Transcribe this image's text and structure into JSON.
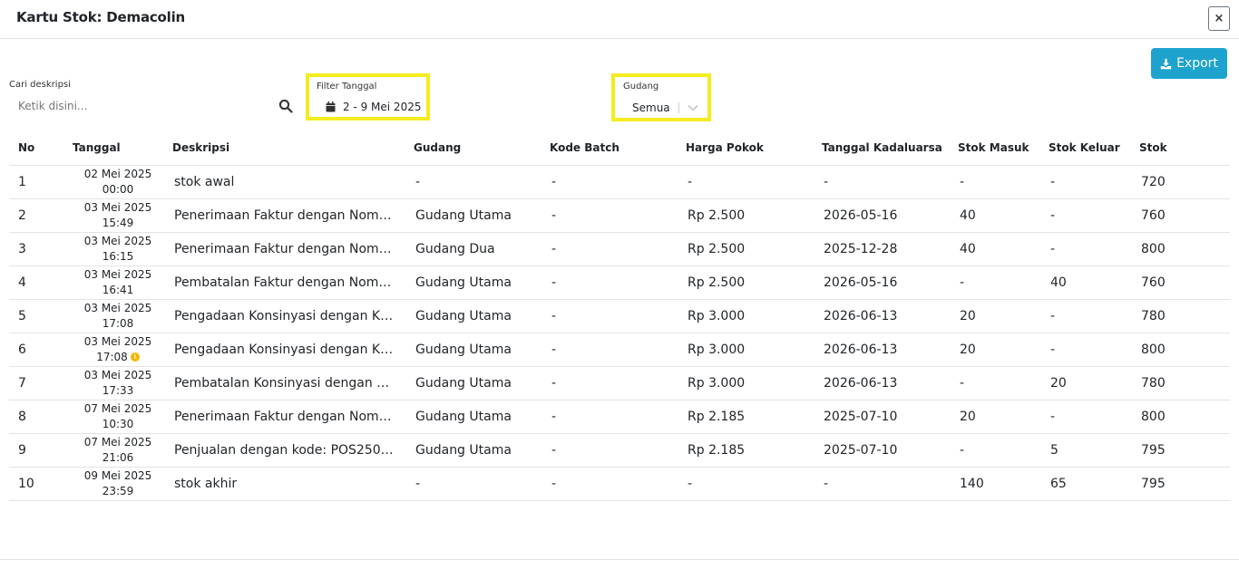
{
  "modal": {
    "title": "Kartu Stok: Demacolin",
    "close_label": "×"
  },
  "toolbar": {
    "export_label": "Export"
  },
  "search": {
    "label": "Cari deskripsi",
    "placeholder": "Ketik disini..."
  },
  "date_filter": {
    "label": "Filter Tanggal",
    "value": "2 - 9 Mei 2025"
  },
  "gudang_filter": {
    "label": "Gudang",
    "value": "Semua"
  },
  "highlight_color": "#f4ec1e",
  "accent_color": "#1ea3cf",
  "table": {
    "headers": [
      "No",
      "Tanggal",
      "Deskripsi",
      "Gudang",
      "Kode Batch",
      "Harga Pokok",
      "Tanggal Kadaluarsa",
      "Stok Masuk",
      "Stok Keluar",
      "Stok"
    ],
    "rows": [
      {
        "no": "1",
        "date": "02 Mei 2025",
        "time": "00:00",
        "info": false,
        "desc": "stok awal",
        "gudang": "-",
        "batch": "-",
        "harga": "-",
        "exp": "-",
        "masuk": "-",
        "keluar": "-",
        "stok": "720"
      },
      {
        "no": "2",
        "date": "03 Mei 2025",
        "time": "15:49",
        "info": false,
        "desc": "Penerimaan Faktur dengan Nom…",
        "gudang": "Gudang Utama",
        "batch": "-",
        "harga": "Rp 2.500",
        "exp": "2026-05-16",
        "masuk": "40",
        "keluar": "-",
        "stok": "760"
      },
      {
        "no": "3",
        "date": "03 Mei 2025",
        "time": "16:15",
        "info": false,
        "desc": "Penerimaan Faktur dengan Nom…",
        "gudang": "Gudang Dua",
        "batch": "-",
        "harga": "Rp 2.500",
        "exp": "2025-12-28",
        "masuk": "40",
        "keluar": "-",
        "stok": "800"
      },
      {
        "no": "4",
        "date": "03 Mei 2025",
        "time": "16:41",
        "info": false,
        "desc": "Pembatalan Faktur dengan Nom…",
        "gudang": "Gudang Utama",
        "batch": "-",
        "harga": "Rp 2.500",
        "exp": "2026-05-16",
        "masuk": "-",
        "keluar": "40",
        "stok": "760"
      },
      {
        "no": "5",
        "date": "03 Mei 2025",
        "time": "17:08",
        "info": false,
        "desc": "Pengadaan Konsinyasi dengan K…",
        "gudang": "Gudang Utama",
        "batch": "-",
        "harga": "Rp 3.000",
        "exp": "2026-06-13",
        "masuk": "20",
        "keluar": "-",
        "stok": "780"
      },
      {
        "no": "6",
        "date": "03 Mei 2025",
        "time": "17:08",
        "info": true,
        "desc": "Pengadaan Konsinyasi dengan K…",
        "gudang": "Gudang Utama",
        "batch": "-",
        "harga": "Rp 3.000",
        "exp": "2026-06-13",
        "masuk": "20",
        "keluar": "-",
        "stok": "800"
      },
      {
        "no": "7",
        "date": "03 Mei 2025",
        "time": "17:33",
        "info": false,
        "desc": "Pembatalan Konsinyasi dengan …",
        "gudang": "Gudang Utama",
        "batch": "-",
        "harga": "Rp 3.000",
        "exp": "2026-06-13",
        "masuk": "-",
        "keluar": "20",
        "stok": "780"
      },
      {
        "no": "8",
        "date": "07 Mei 2025",
        "time": "10:30",
        "info": false,
        "desc": "Penerimaan Faktur dengan Nom…",
        "gudang": "Gudang Utama",
        "batch": "-",
        "harga": "Rp 2.185",
        "exp": "2025-07-10",
        "masuk": "20",
        "keluar": "-",
        "stok": "800"
      },
      {
        "no": "9",
        "date": "07 Mei 2025",
        "time": "21:06",
        "info": false,
        "desc": "Penjualan dengan kode: POS250…",
        "gudang": "Gudang Utama",
        "batch": "-",
        "harga": "Rp 2.185",
        "exp": "2025-07-10",
        "masuk": "-",
        "keluar": "5",
        "stok": "795"
      },
      {
        "no": "10",
        "date": "09 Mei 2025",
        "time": "23:59",
        "info": false,
        "desc": "stok akhir",
        "gudang": "-",
        "batch": "-",
        "harga": "-",
        "exp": "-",
        "masuk": "140",
        "keluar": "65",
        "stok": "795"
      }
    ]
  }
}
